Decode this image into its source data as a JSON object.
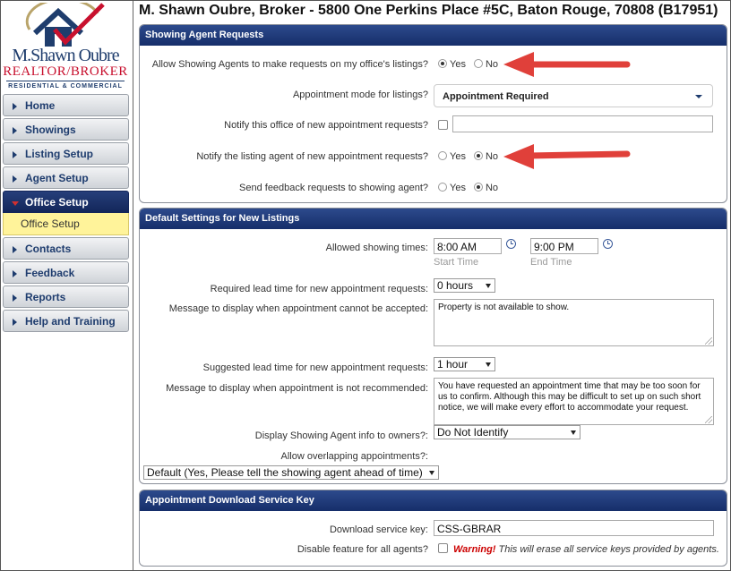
{
  "logo": {
    "name": "M.Shawn Oubre",
    "title": "REALTOR/BROKER",
    "tagline": "RESIDENTIAL & COMMERCIAL"
  },
  "nav": {
    "items": [
      {
        "label": "Home"
      },
      {
        "label": "Showings"
      },
      {
        "label": "Listing Setup"
      },
      {
        "label": "Agent Setup"
      },
      {
        "label": "Office Setup"
      },
      {
        "label": "Contacts"
      },
      {
        "label": "Feedback"
      },
      {
        "label": "Reports"
      },
      {
        "label": "Help and Training"
      }
    ],
    "sub_item": "Office Setup"
  },
  "page_title": "M. Shawn Oubre, Broker - 5800 One Perkins Place #5C, Baton Rouge, 70808 (B17951)",
  "showing_requests": {
    "header": "Showing Agent Requests",
    "allow_label": "Allow Showing Agents to make requests on my office's listings?",
    "yes": "Yes",
    "no": "No",
    "mode_label": "Appointment mode for listings?",
    "mode_value": "Appointment Required",
    "notify_office_label": "Notify this office of new appointment requests?",
    "notify_office_value": "",
    "notify_agent_label": "Notify the listing agent of new appointment requests?",
    "feedback_label": "Send feedback requests to showing agent?"
  },
  "defaults": {
    "header": "Default Settings for New Listings",
    "times_label": "Allowed showing times:",
    "start_time": "8:00 AM",
    "start_hint": "Start Time",
    "end_time": "9:00 PM",
    "end_hint": "End Time",
    "lead_label": "Required lead time for new appointment requests:",
    "lead_value": "0 hours",
    "reject_msg_label": "Message to display when appointment cannot be accepted:",
    "reject_msg": "Property is not available to show.",
    "suggested_label": "Suggested lead time for new appointment requests:",
    "suggested_value": "1 hour",
    "notrec_msg_label": "Message to display when appointment is not recommended:",
    "notrec_msg": "You have requested an appointment time that may be too soon for us to confirm.  Although this may be difficult to set up on such short notice, we will make  every effort to accommodate your request.",
    "display_label": "Display Showing Agent info to owners?:",
    "display_value": "Do Not Identify",
    "overlap_label": "Allow overlapping appointments?:",
    "overlap_value": "Default (Yes, Please tell the showing agent ahead of time)"
  },
  "download": {
    "header": "Appointment Download Service Key",
    "key_label": "Download service key:",
    "key_value": "CSS-GBRAR",
    "disable_label": "Disable feature for all agents?",
    "warning": "Warning!",
    "warning_text": " This will erase all service keys provided by agents."
  },
  "colors": {
    "panel_header": "#1f3a7a",
    "nav_text": "#1e3c6e",
    "annotation_arrow": "#e0403a",
    "active_sub_bg": "#fff39a"
  }
}
